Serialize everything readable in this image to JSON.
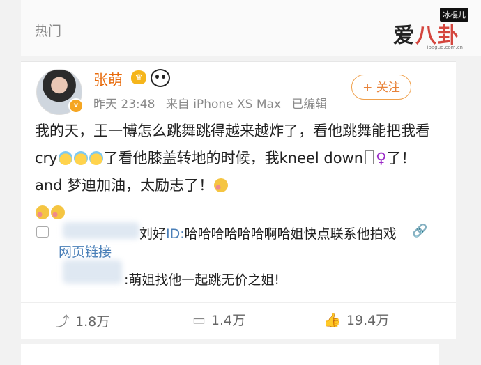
{
  "header": {
    "section_title": "热门"
  },
  "watermark": {
    "tag": "冰棍儿",
    "logo_a": "爱",
    "logo_b": "八卦",
    "url": "ibaguo.com.cn"
  },
  "post": {
    "username": "张萌",
    "avatar_badge": "v",
    "crown_icon_text": "♛",
    "time": "昨天 23:48",
    "source": "来自 iPhone XS Max",
    "edited": "已编辑",
    "follow_label": "+ 关注",
    "text_1": "我的天，王一博怎么跳舞跳得越来越炸了，看他跳舞能把我看cry",
    "text_2": "了看他膝盖转地的时候，我kneel down",
    "text_female": "♀",
    "text_3": "了！ and 梦迪加油，太励志了！",
    "comment_1_prefix": "刘好",
    "comment_1_id": "ID:",
    "comment_1_text": "哈哈哈哈哈哈啊哈姐快点联系他拍戏",
    "link_icon": "🔗",
    "webpage_link": "网页链接",
    "comment_2_text": ":萌姐找他一起跳无价之姐!",
    "actions": {
      "repost_icon": "⤴",
      "repost_count": "1.8万",
      "comment_icon": "▭",
      "comment_count": "1.4万",
      "like_icon": "👍",
      "like_count": "19.4万"
    }
  }
}
